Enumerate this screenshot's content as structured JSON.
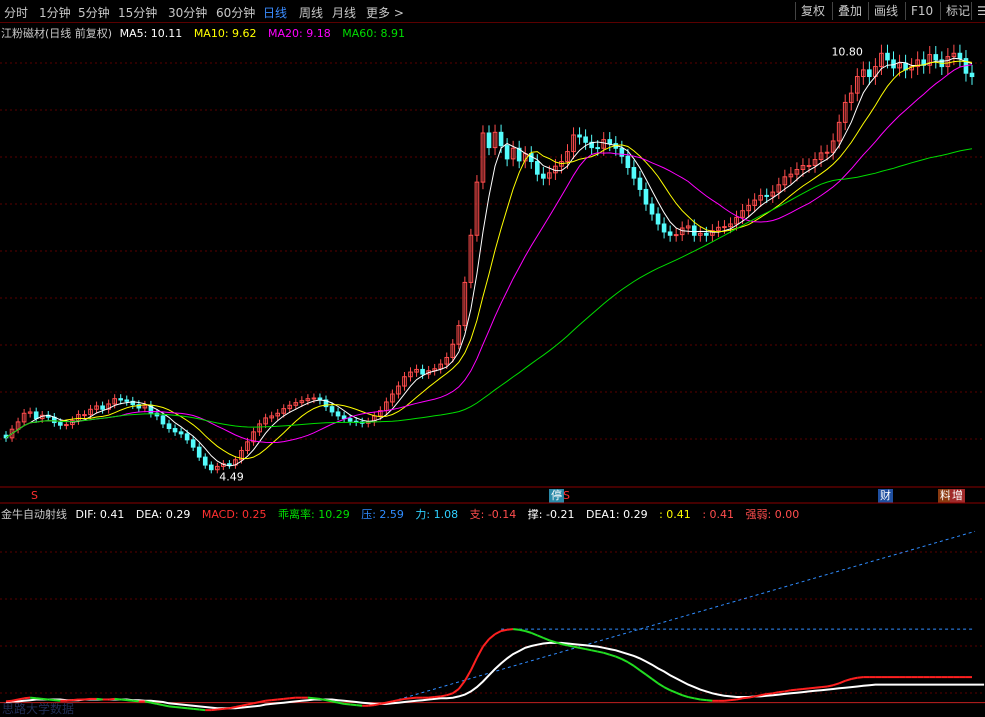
{
  "toolbar": {
    "timeframes": [
      "分时",
      "1分钟",
      "5分钟",
      "15分钟",
      "30分钟",
      "60分钟",
      "日线",
      "周线",
      "月线",
      "更多 >"
    ],
    "active": "日线",
    "right_buttons": [
      "复权",
      "叠加",
      "画线",
      "F10",
      "标记"
    ],
    "menu_glyph": "☰"
  },
  "main_info": {
    "title": "江粉磁材(日线 前复权)",
    "ma5": "MA5: 10.11",
    "ma10": "MA10: 9.62",
    "ma20": "MA20: 9.18",
    "ma60": "MA60: 8.91"
  },
  "indicator_info": {
    "name": "金牛自动射线",
    "dif": "DIF: 0.41",
    "dea": "DEA: 0.29",
    "macd": "MACD: 0.25",
    "bias": "乖离率: 10.29",
    "ya": "压: 2.59",
    "li": "力: 1.08",
    "zhi": "支: -0.14",
    "cheng": "撑: -0.21",
    "dea1": "DEA1: 0.29",
    "v1": ": 0.41",
    "v2": ": 0.41",
    "qiangruo": "强弱: 0.00"
  },
  "markers": {
    "s1": "S",
    "ting": "停",
    "s2": "S",
    "cai": "财",
    "zeng_prefix": "料",
    "zeng": "增"
  },
  "watermark": "思路大学数据",
  "colors": {
    "up": "#ff4d4d",
    "down": "#54fcfc",
    "ma5": "#ffffff",
    "ma10": "#ffff00",
    "ma20": "#ff00ff",
    "ma60": "#00dd00",
    "dif": "#ffffff",
    "dea": "#ffff00",
    "ray": "#2f8cff",
    "grid": "#5a0000"
  },
  "chart_data": [
    {
      "type": "candlestick",
      "title": "江粉磁材(日线 前复权)",
      "annotations": [
        {
          "label": "4.49",
          "kind": "low"
        },
        {
          "label": "10.80",
          "kind": "high"
        }
      ],
      "low_value": 4.49,
      "high_value": 10.8,
      "x": [
        0,
        1,
        2,
        3,
        4,
        5,
        6,
        7,
        8,
        9,
        10,
        11,
        12,
        13,
        14,
        15,
        16,
        17,
        18,
        19,
        20,
        21,
        22,
        23,
        24,
        25,
        26,
        27,
        28,
        29,
        30,
        31,
        32,
        33,
        34,
        35,
        36,
        37,
        38,
        39,
        40,
        41,
        42,
        43,
        44,
        45,
        46,
        47,
        48,
        49,
        50,
        51,
        52,
        53,
        54,
        55,
        56,
        57,
        58,
        59,
        60,
        61,
        62,
        63,
        64,
        65,
        66,
        67,
        68,
        69,
        70,
        71,
        72,
        73,
        74,
        75,
        76,
        77,
        78,
        79,
        80,
        81,
        82,
        83,
        84,
        85,
        86,
        87,
        88,
        89,
        90,
        91,
        92,
        93,
        94,
        95,
        96,
        97,
        98,
        99,
        100,
        101,
        102,
        103,
        104,
        105,
        106,
        107,
        108,
        109,
        110,
        111,
        112,
        113,
        114,
        115,
        116,
        117,
        118,
        119,
        120,
        121,
        122,
        123,
        124,
        125,
        126,
        127,
        128,
        129,
        130,
        131,
        132,
        133,
        134,
        135,
        136,
        137,
        138,
        139,
        140,
        141,
        142,
        143,
        144,
        145,
        146,
        147,
        148,
        149,
        150,
        151,
        152,
        153,
        154,
        155,
        156,
        157,
        158,
        159,
        160
      ],
      "open": [
        5.05,
        5.01,
        5.14,
        5.25,
        5.38,
        5.4,
        5.3,
        5.35,
        5.32,
        5.24,
        5.2,
        5.21,
        5.27,
        5.36,
        5.36,
        5.44,
        5.49,
        5.44,
        5.52,
        5.6,
        5.58,
        5.56,
        5.51,
        5.46,
        5.5,
        5.38,
        5.34,
        5.22,
        5.15,
        5.1,
        5.07,
        4.98,
        4.87,
        4.72,
        4.6,
        4.53,
        4.58,
        4.62,
        4.6,
        4.68,
        4.82,
        4.95,
        5.1,
        5.22,
        5.31,
        5.34,
        5.38,
        5.45,
        5.5,
        5.54,
        5.57,
        5.6,
        5.61,
        5.58,
        5.48,
        5.4,
        5.34,
        5.3,
        5.26,
        5.25,
        5.23,
        5.25,
        5.34,
        5.42,
        5.55,
        5.67,
        5.79,
        5.93,
        6.0,
        6.04,
        5.97,
        6.02,
        6.05,
        6.12,
        6.22,
        6.42,
        6.7,
        7.35,
        8.06,
        8.86,
        9.6,
        9.38,
        9.61,
        9.41,
        9.21,
        9.37,
        9.18,
        9.29,
        9.17,
        8.98,
        8.92,
        9.0,
        9.1,
        9.17,
        9.32,
        9.57,
        9.54,
        9.46,
        9.38,
        9.37,
        9.5,
        9.44,
        9.37,
        9.25,
        9.08,
        8.92,
        8.75,
        8.53,
        8.38,
        8.23,
        8.11,
        8.06,
        8.07,
        8.17,
        8.2,
        8.06,
        8.09,
        8.06,
        8.13,
        8.18,
        8.19,
        8.23,
        8.33,
        8.43,
        8.51,
        8.59,
        8.66,
        8.65,
        8.71,
        8.82,
        8.94,
        8.98,
        9.05,
        9.11,
        9.11,
        9.2,
        9.3,
        9.31,
        9.48,
        9.76,
        10.06,
        10.2,
        10.45,
        10.55,
        10.45,
        10.6,
        10.8,
        10.7,
        10.58,
        10.65,
        10.55,
        10.6,
        10.7,
        10.62,
        10.78,
        10.7,
        10.6,
        10.75,
        10.8,
        10.72,
        10.5
      ],
      "close": [
        5.01,
        5.14,
        5.25,
        5.38,
        5.4,
        5.3,
        5.35,
        5.32,
        5.24,
        5.2,
        5.21,
        5.27,
        5.36,
        5.36,
        5.44,
        5.49,
        5.44,
        5.52,
        5.6,
        5.58,
        5.56,
        5.51,
        5.46,
        5.5,
        5.38,
        5.34,
        5.22,
        5.15,
        5.1,
        5.07,
        4.98,
        4.87,
        4.72,
        4.6,
        4.53,
        4.58,
        4.62,
        4.6,
        4.68,
        4.82,
        4.95,
        5.1,
        5.22,
        5.31,
        5.34,
        5.38,
        5.45,
        5.5,
        5.54,
        5.57,
        5.6,
        5.61,
        5.58,
        5.48,
        5.4,
        5.34,
        5.3,
        5.26,
        5.25,
        5.23,
        5.25,
        5.34,
        5.42,
        5.55,
        5.67,
        5.79,
        5.93,
        6.0,
        6.04,
        5.97,
        6.02,
        6.05,
        6.12,
        6.22,
        6.42,
        6.7,
        7.35,
        8.06,
        8.86,
        9.6,
        9.38,
        9.61,
        9.41,
        9.21,
        9.37,
        9.18,
        9.29,
        9.17,
        8.98,
        8.92,
        9.0,
        9.1,
        9.17,
        9.32,
        9.57,
        9.54,
        9.46,
        9.38,
        9.37,
        9.5,
        9.44,
        9.37,
        9.25,
        9.08,
        8.92,
        8.75,
        8.53,
        8.38,
        8.23,
        8.11,
        8.06,
        8.07,
        8.17,
        8.2,
        8.06,
        8.09,
        8.06,
        8.13,
        8.18,
        8.19,
        8.23,
        8.33,
        8.43,
        8.51,
        8.59,
        8.66,
        8.65,
        8.71,
        8.82,
        8.94,
        8.98,
        9.05,
        9.11,
        9.11,
        9.2,
        9.3,
        9.31,
        9.48,
        9.76,
        10.06,
        10.2,
        10.45,
        10.55,
        10.45,
        10.6,
        10.8,
        10.7,
        10.58,
        10.65,
        10.55,
        10.6,
        10.7,
        10.62,
        10.78,
        10.7,
        10.6,
        10.75,
        10.8,
        10.72,
        10.5,
        10.45
      ],
      "ylim": [
        4.3,
        11.0
      ]
    },
    {
      "type": "line",
      "title": "金牛自动射线",
      "series": [
        {
          "name": "DIF",
          "values": [
            0.02,
            0.03,
            0.05,
            0.07,
            0.08,
            0.07,
            0.06,
            0.05,
            0.04,
            0.03,
            0.03,
            0.04,
            0.05,
            0.05,
            0.06,
            0.06,
            0.05,
            0.05,
            0.06,
            0.05,
            0.04,
            0.03,
            0.02,
            0.02,
            0.0,
            -0.02,
            -0.04,
            -0.06,
            -0.07,
            -0.08,
            -0.09,
            -0.1,
            -0.11,
            -0.12,
            -0.12,
            -0.11,
            -0.1,
            -0.09,
            -0.07,
            -0.05,
            -0.03,
            -0.01,
            0.01,
            0.03,
            0.04,
            0.05,
            0.06,
            0.07,
            0.08,
            0.08,
            0.08,
            0.07,
            0.06,
            0.04,
            0.02,
            0.0,
            -0.02,
            -0.03,
            -0.04,
            -0.05,
            -0.05,
            -0.04,
            -0.02,
            0.0,
            0.02,
            0.04,
            0.06,
            0.07,
            0.08,
            0.08,
            0.08,
            0.09,
            0.1,
            0.12,
            0.15,
            0.22,
            0.35,
            0.52,
            0.72,
            0.9,
            1.02,
            1.1,
            1.15,
            1.17,
            1.18,
            1.17,
            1.15,
            1.12,
            1.08,
            1.04,
            1.0,
            0.97,
            0.94,
            0.92,
            0.9,
            0.88,
            0.86,
            0.84,
            0.82,
            0.8,
            0.77,
            0.74,
            0.7,
            0.65,
            0.59,
            0.52,
            0.45,
            0.38,
            0.31,
            0.25,
            0.2,
            0.16,
            0.12,
            0.09,
            0.07,
            0.05,
            0.04,
            0.03,
            0.03,
            0.03,
            0.04,
            0.05,
            0.07,
            0.08,
            0.1,
            0.12,
            0.14,
            0.15,
            0.17,
            0.18,
            0.2,
            0.21,
            0.22,
            0.23,
            0.24,
            0.25,
            0.26,
            0.28,
            0.31,
            0.35,
            0.38,
            0.4,
            0.41,
            0.41,
            0.41,
            0.41,
            0.41,
            0.41,
            0.41,
            0.41,
            0.41,
            0.41,
            0.41,
            0.41,
            0.41,
            0.41,
            0.41,
            0.41,
            0.41,
            0.41,
            0.41
          ]
        },
        {
          "name": "DEA",
          "values": [
            0.01,
            0.02,
            0.02,
            0.03,
            0.04,
            0.05,
            0.05,
            0.05,
            0.05,
            0.05,
            0.04,
            0.04,
            0.04,
            0.05,
            0.05,
            0.05,
            0.05,
            0.05,
            0.05,
            0.05,
            0.05,
            0.04,
            0.04,
            0.03,
            0.03,
            0.02,
            0.01,
            -0.01,
            -0.02,
            -0.03,
            -0.04,
            -0.05,
            -0.06,
            -0.07,
            -0.08,
            -0.09,
            -0.09,
            -0.09,
            -0.09,
            -0.08,
            -0.07,
            -0.06,
            -0.05,
            -0.03,
            -0.02,
            -0.01,
            0.0,
            0.01,
            0.02,
            0.03,
            0.04,
            0.05,
            0.05,
            0.05,
            0.05,
            0.04,
            0.03,
            0.02,
            0.01,
            0.0,
            -0.01,
            -0.02,
            -0.02,
            -0.02,
            -0.01,
            0.0,
            0.01,
            0.02,
            0.03,
            0.04,
            0.05,
            0.06,
            0.07,
            0.07,
            0.08,
            0.1,
            0.13,
            0.18,
            0.25,
            0.34,
            0.44,
            0.54,
            0.63,
            0.71,
            0.78,
            0.83,
            0.88,
            0.91,
            0.93,
            0.95,
            0.96,
            0.96,
            0.96,
            0.95,
            0.94,
            0.93,
            0.92,
            0.91,
            0.9,
            0.88,
            0.86,
            0.84,
            0.81,
            0.78,
            0.75,
            0.71,
            0.66,
            0.61,
            0.55,
            0.5,
            0.44,
            0.39,
            0.34,
            0.29,
            0.25,
            0.21,
            0.18,
            0.15,
            0.13,
            0.11,
            0.1,
            0.09,
            0.09,
            0.09,
            0.1,
            0.1,
            0.11,
            0.12,
            0.13,
            0.14,
            0.15,
            0.16,
            0.17,
            0.18,
            0.19,
            0.2,
            0.21,
            0.22,
            0.23,
            0.24,
            0.25,
            0.26,
            0.27,
            0.28,
            0.29,
            0.29,
            0.29,
            0.29,
            0.29,
            0.29,
            0.29,
            0.29,
            0.29,
            0.29,
            0.29,
            0.29,
            0.29,
            0.29,
            0.29,
            0.29,
            0.29,
            0.29,
            0.29
          ]
        }
      ],
      "ylim": [
        -0.15,
        2.9
      ]
    }
  ]
}
